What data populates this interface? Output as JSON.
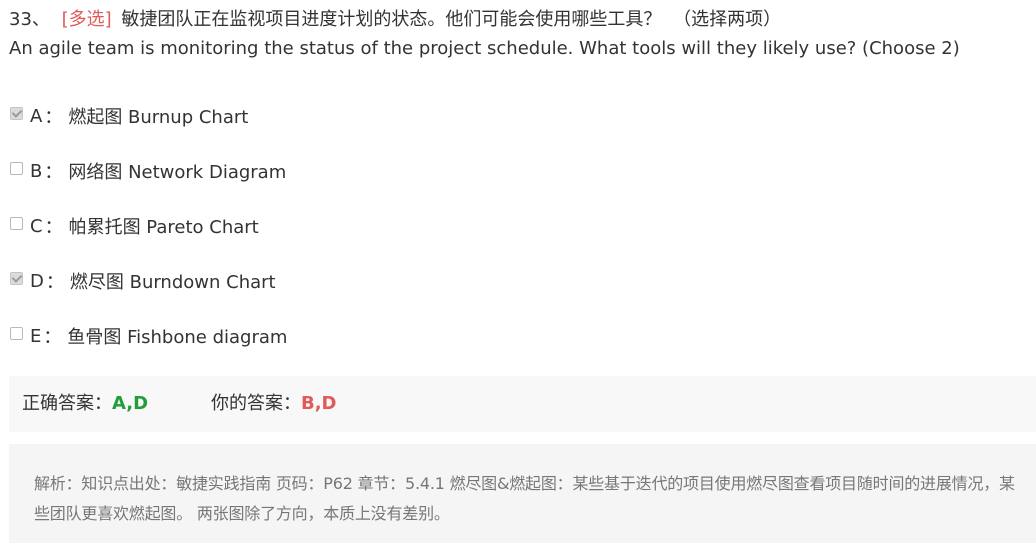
{
  "question": {
    "number": "33、",
    "type_tag": "[多选]",
    "text_zh": "敏捷团队正在监视项目进度计划的状态。他们可能会使用哪些工具？",
    "note": "（选择两项）",
    "text_en": "An agile team is monitoring the status of the project schedule. What tools will they likely use? (Choose 2)"
  },
  "options": [
    {
      "letter": "A",
      "colon": "：",
      "text": "燃起图 Burnup Chart",
      "checked": true
    },
    {
      "letter": "B",
      "colon": "：",
      "text": "网络图 Network Diagram",
      "checked": false
    },
    {
      "letter": "C",
      "colon": "：",
      "text": "帕累托图 Pareto Chart",
      "checked": false
    },
    {
      "letter": "D",
      "colon": "：",
      "text": "燃尽图 Burndown Chart",
      "checked": true
    },
    {
      "letter": "E",
      "colon": "：",
      "text": "鱼骨图 Fishbone diagram",
      "checked": false
    }
  ],
  "answers": {
    "correct_label": "正确答案：",
    "correct_value": "A,D",
    "yours_label": "你的答案：",
    "yours_value": "B,D"
  },
  "analysis": {
    "text": "解析：知识点出处：敏捷实践指南 页码：P62 章节：5.4.1 燃尽图&燃起图：某些基于迭代的项目使用燃尽图查看项目随时间的进展情况，某些团队更喜欢燃起图。 两张图除了方向，本质上没有差别。"
  },
  "colors": {
    "type_tag": "#e05a5a",
    "correct": "#1f9e3a",
    "yours": "#e05a5a",
    "analysis_bg": "#f5f5f5",
    "answer_bg": "#f8f8f8"
  }
}
